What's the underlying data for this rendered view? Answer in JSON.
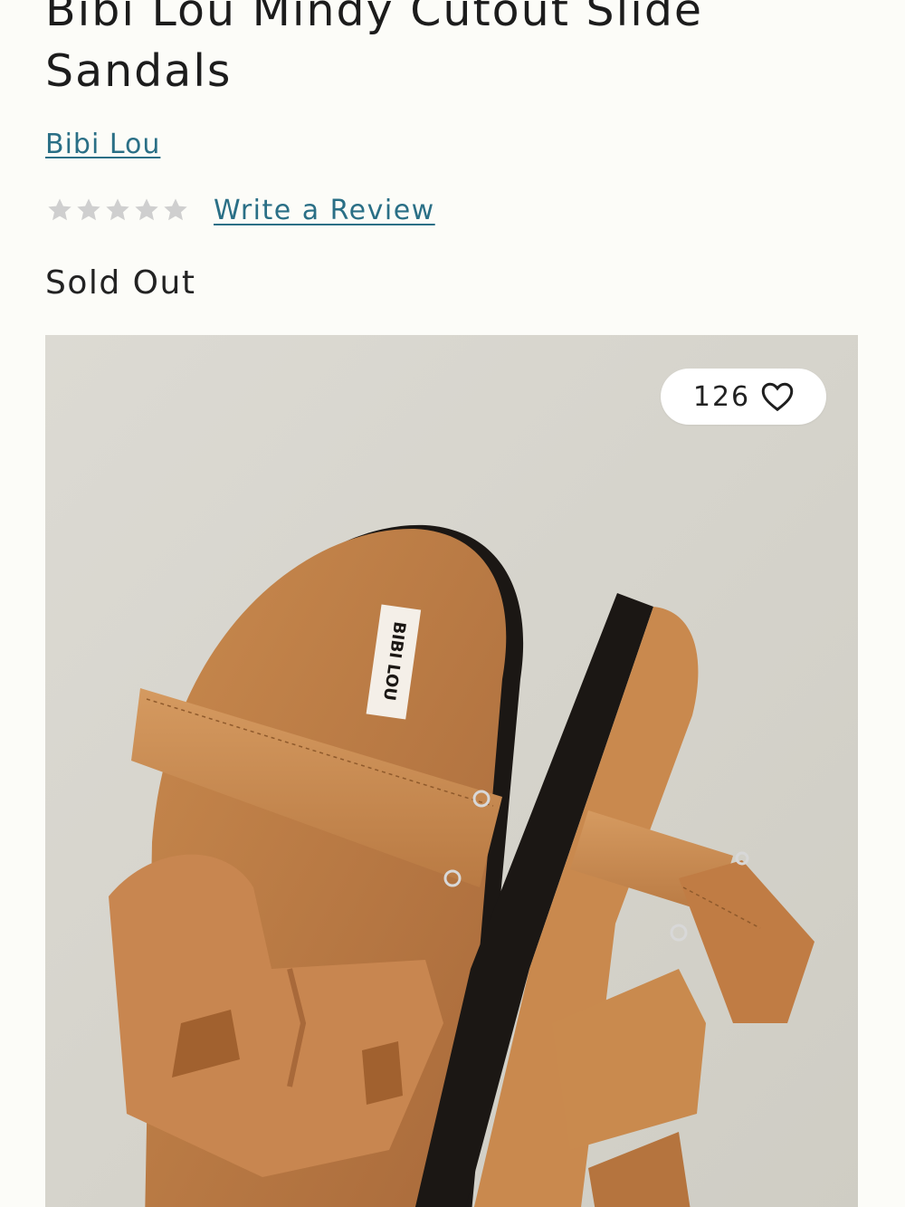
{
  "product": {
    "title": "Bibi Lou Mindy Cutout Slide Sandals",
    "brand": "Bibi Lou",
    "rating_stars": 0,
    "rating_max": 5,
    "review_link": "Write a Review",
    "stock_status": "Sold Out"
  },
  "image": {
    "label_text": "BIBI LOU",
    "likes": "126",
    "heart_icon": "heart-outline-icon"
  },
  "colors": {
    "link": "#2a6f86",
    "star_empty": "#cfcfcf",
    "background": "#fcfcf8",
    "image_bg": "#d8d6ce",
    "leather": "#c8884a",
    "sole": "#1b1714"
  }
}
